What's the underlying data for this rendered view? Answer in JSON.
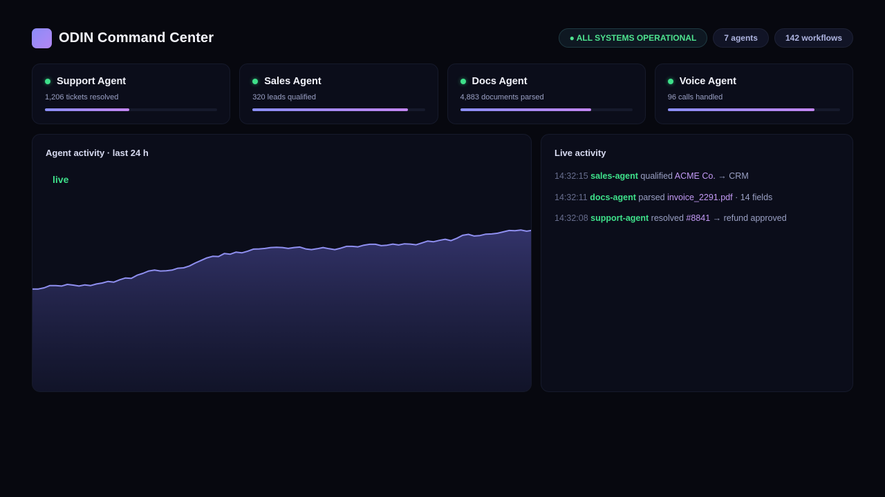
{
  "header": {
    "title": "ODIN Command Center",
    "status": "● ALL SYSTEMS OPERATIONAL",
    "agents_count": "7 agents",
    "workflows_count": "142 workflows"
  },
  "agents": [
    {
      "name": "Support Agent",
      "stat": "1,206 tickets resolved",
      "progress": 0.49
    },
    {
      "name": "Sales Agent",
      "stat": "320 leads qualified",
      "progress": 0.9
    },
    {
      "name": "Docs Agent",
      "stat": "4,883 documents parsed",
      "progress": 0.76
    },
    {
      "name": "Voice Agent",
      "stat": "96 calls handled",
      "progress": 0.85
    }
  ],
  "colors": {
    "background": "#07080f",
    "panel": "#0b0d1a",
    "accent_start": "#8a8ef6",
    "accent_end": "#c386f3",
    "status_green": "#3ee08a",
    "highlight_purple": "#c39af5"
  },
  "activity_chart": {
    "title": "Agent activity · last 24 h",
    "live_label": "live",
    "chart_data": {
      "type": "area",
      "title": "Agent activity · last 24 h",
      "xlabel": "",
      "ylabel": "",
      "ylim": [
        0,
        100
      ],
      "values": [
        45,
        45,
        45.5,
        46.5,
        46.5,
        46.3,
        47,
        46.7,
        46.3,
        46.8,
        46.5,
        47.2,
        47.6,
        48.3,
        48,
        49,
        49.8,
        49.6,
        51,
        51.8,
        52.8,
        53.2,
        52.8,
        52.9,
        53.2,
        54,
        54.2,
        55,
        56.3,
        57.4,
        58.5,
        59.2,
        59.1,
        60.4,
        60.1,
        61,
        60.7,
        61.4,
        62.3,
        62.4,
        62.6,
        63,
        63.1,
        63,
        62.6,
        63,
        63.2,
        62.4,
        62.1,
        62.5,
        63,
        62.5,
        62.1,
        62.7,
        63.5,
        63.5,
        63.3,
        64,
        64.4,
        64.4,
        63.8,
        64,
        64.5,
        64.1,
        64.6,
        64.5,
        64.2,
        65,
        65.8,
        65.5,
        66.1,
        66.6,
        66,
        67,
        68.3,
        68.7,
        68,
        68.2,
        68.8,
        68.9,
        69.2,
        69.8,
        70.4,
        70.3,
        70.6,
        70.1,
        70.5
      ]
    }
  },
  "live_feed": {
    "title": "Live activity",
    "rows": [
      {
        "time": "14:32:15",
        "agent": "sales-agent",
        "pre": " qualified ",
        "subject": "ACME Co.",
        "post": " → CRM"
      },
      {
        "time": "14:32:11",
        "agent": "docs-agent",
        "pre": " parsed ",
        "subject": "invoice_2291.pdf",
        "post": " · 14 fields"
      },
      {
        "time": "14:32:08",
        "agent": "support-agent",
        "pre": " resolved ",
        "subject": "#8841",
        "post": " → refund approved"
      }
    ]
  }
}
